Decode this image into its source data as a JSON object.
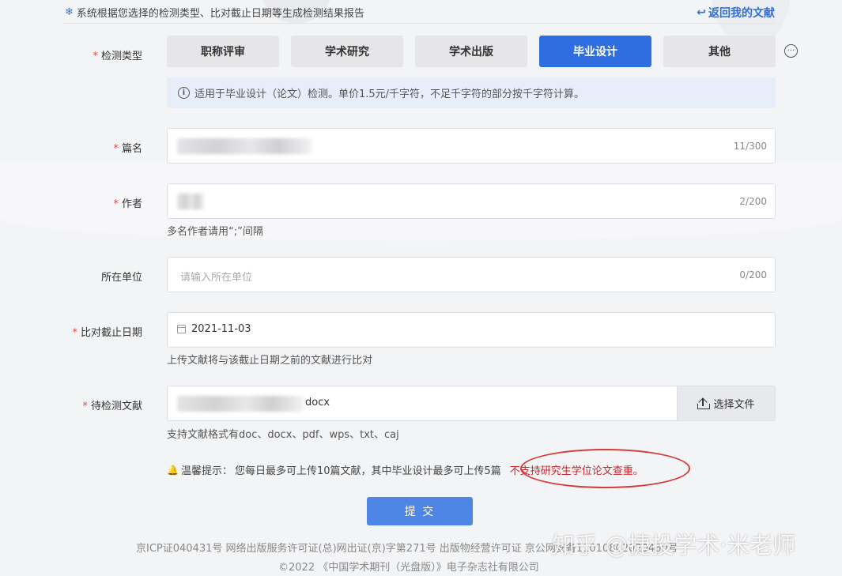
{
  "header": {
    "notice": "系统根据您选择的检测类型、比对截止日期等生成检测结果报告",
    "back_link": "返回我的文献"
  },
  "form": {
    "type_label": "检测类型",
    "types": [
      "职称评审",
      "学术研究",
      "学术出版",
      "毕业设计",
      "其他"
    ],
    "active_type": "毕业设计",
    "info": "适用于毕业设计（论文）检测。单价1.5元/千字符，不足千字符的部分按千字符计算。",
    "title_label": "篇名",
    "title_counter": "11/300",
    "author_label": "作者",
    "author_counter": "2/200",
    "author_hint": "多名作者请用“;”间隔",
    "org_label": "所在单位",
    "org_placeholder": "请输入所在单位",
    "org_counter": "0/200",
    "date_label": "比对截止日期",
    "date_value": "2021-11-03",
    "date_hint": "上传文献将与该截止日期之前的文献进行比对",
    "doc_label": "待检测文献",
    "doc_filename_suffix": "docx",
    "choose_file": "选择文件",
    "formats_hint": "支持文献格式有doc、docx、pdf、wps、txt、caj",
    "tip_prefix": "温馨提示：",
    "tip_main": "您每日最多可上传10篇文献，其中毕业设计最多可上传5篇",
    "tip_red": "不支持研究生学位论文查重。",
    "submit": "提 交"
  },
  "footer": {
    "line1": "京ICP证040431号 网络出版服务许可证(总)网出证(京)字第271号 出版物经营许可证 京公网安备11010802020460号",
    "line2": "©2022 《中国学术期刊（光盘版）》电子杂志社有限公司"
  },
  "watermark": "知乎 @捷投学术·米老师",
  "colors": {
    "primary": "#2f6ee0",
    "required": "#e04848",
    "warning_red": "#c8242a"
  }
}
